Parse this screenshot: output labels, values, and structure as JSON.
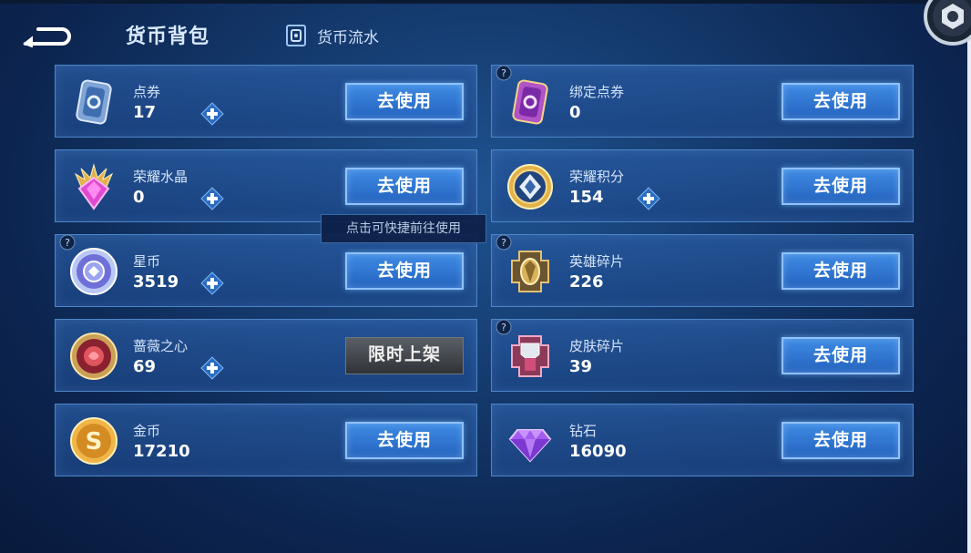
{
  "header": {
    "title": "货币背包",
    "flow_label": "货币流水"
  },
  "tooltip": "点击可快捷前往使用",
  "currencies": [
    {
      "name": "点券",
      "amount": "17",
      "action": "去使用",
      "has_plus": true,
      "has_help": false,
      "icon": "voucher-icon"
    },
    {
      "name": "绑定点券",
      "amount": "0",
      "action": "去使用",
      "has_plus": false,
      "has_help": true,
      "icon": "bound-voucher-icon"
    },
    {
      "name": "荣耀水晶",
      "amount": "0",
      "action": "去使用",
      "has_plus": true,
      "has_help": false,
      "icon": "glory-crystal-icon"
    },
    {
      "name": "荣耀积分",
      "amount": "154",
      "action": "去使用",
      "has_plus": true,
      "has_help": false,
      "icon": "glory-points-icon"
    },
    {
      "name": "星币",
      "amount": "3519",
      "action": "去使用",
      "has_plus": true,
      "has_help": true,
      "icon": "star-coin-icon"
    },
    {
      "name": "英雄碎片",
      "amount": "226",
      "action": "去使用",
      "has_plus": false,
      "has_help": true,
      "icon": "hero-fragment-icon"
    },
    {
      "name": "蔷薇之心",
      "amount": "69",
      "action": "限时上架",
      "has_plus": true,
      "has_help": false,
      "icon": "rose-heart-icon",
      "action_disabled": true
    },
    {
      "name": "皮肤碎片",
      "amount": "39",
      "action": "去使用",
      "has_plus": false,
      "has_help": true,
      "icon": "skin-fragment-icon"
    },
    {
      "name": "金币",
      "amount": "17210",
      "action": "去使用",
      "has_plus": false,
      "has_help": false,
      "icon": "gold-coin-icon"
    },
    {
      "name": "钻石",
      "amount": "16090",
      "action": "去使用",
      "has_plus": false,
      "has_help": false,
      "icon": "diamond-icon"
    }
  ],
  "colors": {
    "accent": "#3f8be4",
    "card_border": "#4d86c8",
    "background": "#153c70"
  }
}
